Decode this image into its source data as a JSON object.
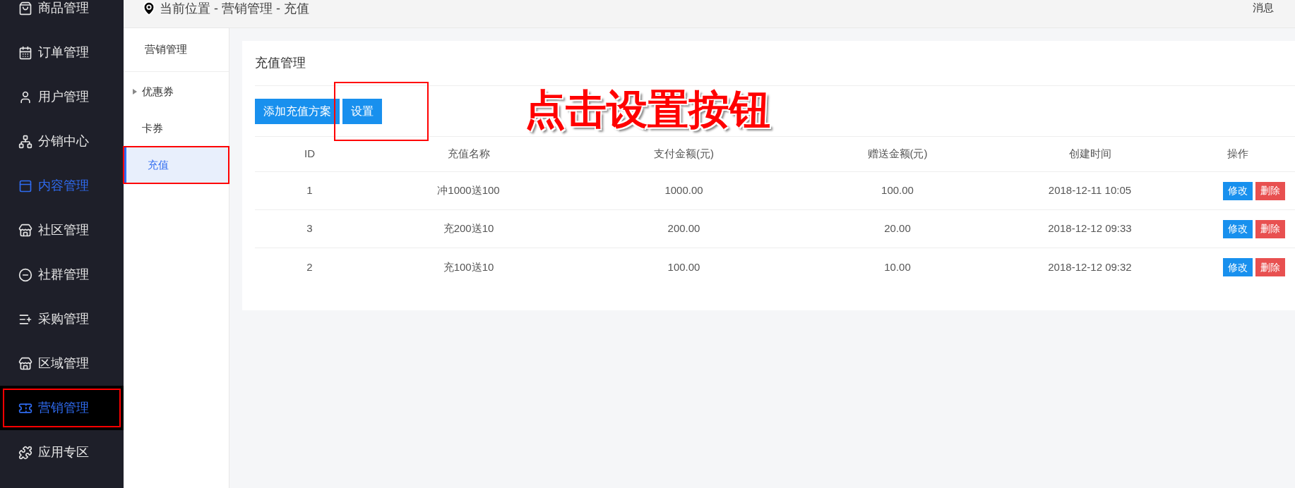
{
  "sidebar": {
    "items": [
      {
        "label": "商品管理",
        "active": false,
        "selected": false,
        "highlighted": false
      },
      {
        "label": "订单管理",
        "active": false,
        "selected": false,
        "highlighted": false
      },
      {
        "label": "用户管理",
        "active": false,
        "selected": false,
        "highlighted": false
      },
      {
        "label": "分销中心",
        "active": false,
        "selected": false,
        "highlighted": false
      },
      {
        "label": "内容管理",
        "active": true,
        "selected": false,
        "highlighted": false
      },
      {
        "label": "社区管理",
        "active": false,
        "selected": false,
        "highlighted": false
      },
      {
        "label": "社群管理",
        "active": false,
        "selected": false,
        "highlighted": false
      },
      {
        "label": "采购管理",
        "active": false,
        "selected": false,
        "highlighted": false
      },
      {
        "label": "区域管理",
        "active": false,
        "selected": false,
        "highlighted": false
      },
      {
        "label": "营销管理",
        "active": true,
        "selected": true,
        "highlighted": true
      },
      {
        "label": "应用专区",
        "active": false,
        "selected": false,
        "highlighted": false
      }
    ]
  },
  "header": {
    "breadcrumb": "当前位置 - 营销管理 - 充值",
    "messages": "消息"
  },
  "submenu": {
    "title": "营销管理",
    "items": [
      {
        "label": "优惠券",
        "expandable": true,
        "selected": false,
        "highlighted": false
      },
      {
        "label": "卡券",
        "expandable": false,
        "selected": false,
        "highlighted": false
      },
      {
        "label": "充值",
        "expandable": false,
        "selected": true,
        "highlighted": true
      }
    ]
  },
  "card": {
    "title": "充值管理",
    "buttons": [
      {
        "label": "添加充值方案",
        "highlighted": false
      },
      {
        "label": "设置",
        "highlighted": true
      }
    ],
    "annotation": "点击设置按钮",
    "table": {
      "columns": [
        "ID",
        "充值名称",
        "支付金额(元)",
        "赠送金额(元)",
        "创建时间",
        "操作"
      ],
      "rows": [
        {
          "cells": [
            "1",
            "冲1000送100",
            "1000.00",
            "100.00",
            "2018-12-11 10:05"
          ],
          "actions": [
            {
              "label": "修改",
              "kind": "edit"
            },
            {
              "label": "删除",
              "kind": "delete"
            }
          ]
        },
        {
          "cells": [
            "3",
            "充200送10",
            "200.00",
            "20.00",
            "2018-12-12 09:33"
          ],
          "actions": [
            {
              "label": "修改",
              "kind": "edit"
            },
            {
              "label": "删除",
              "kind": "delete"
            }
          ]
        },
        {
          "cells": [
            "2",
            "充100送10",
            "100.00",
            "10.00",
            "2018-12-12 09:32"
          ],
          "actions": [
            {
              "label": "修改",
              "kind": "edit"
            },
            {
              "label": "删除",
              "kind": "delete"
            }
          ]
        }
      ]
    }
  }
}
